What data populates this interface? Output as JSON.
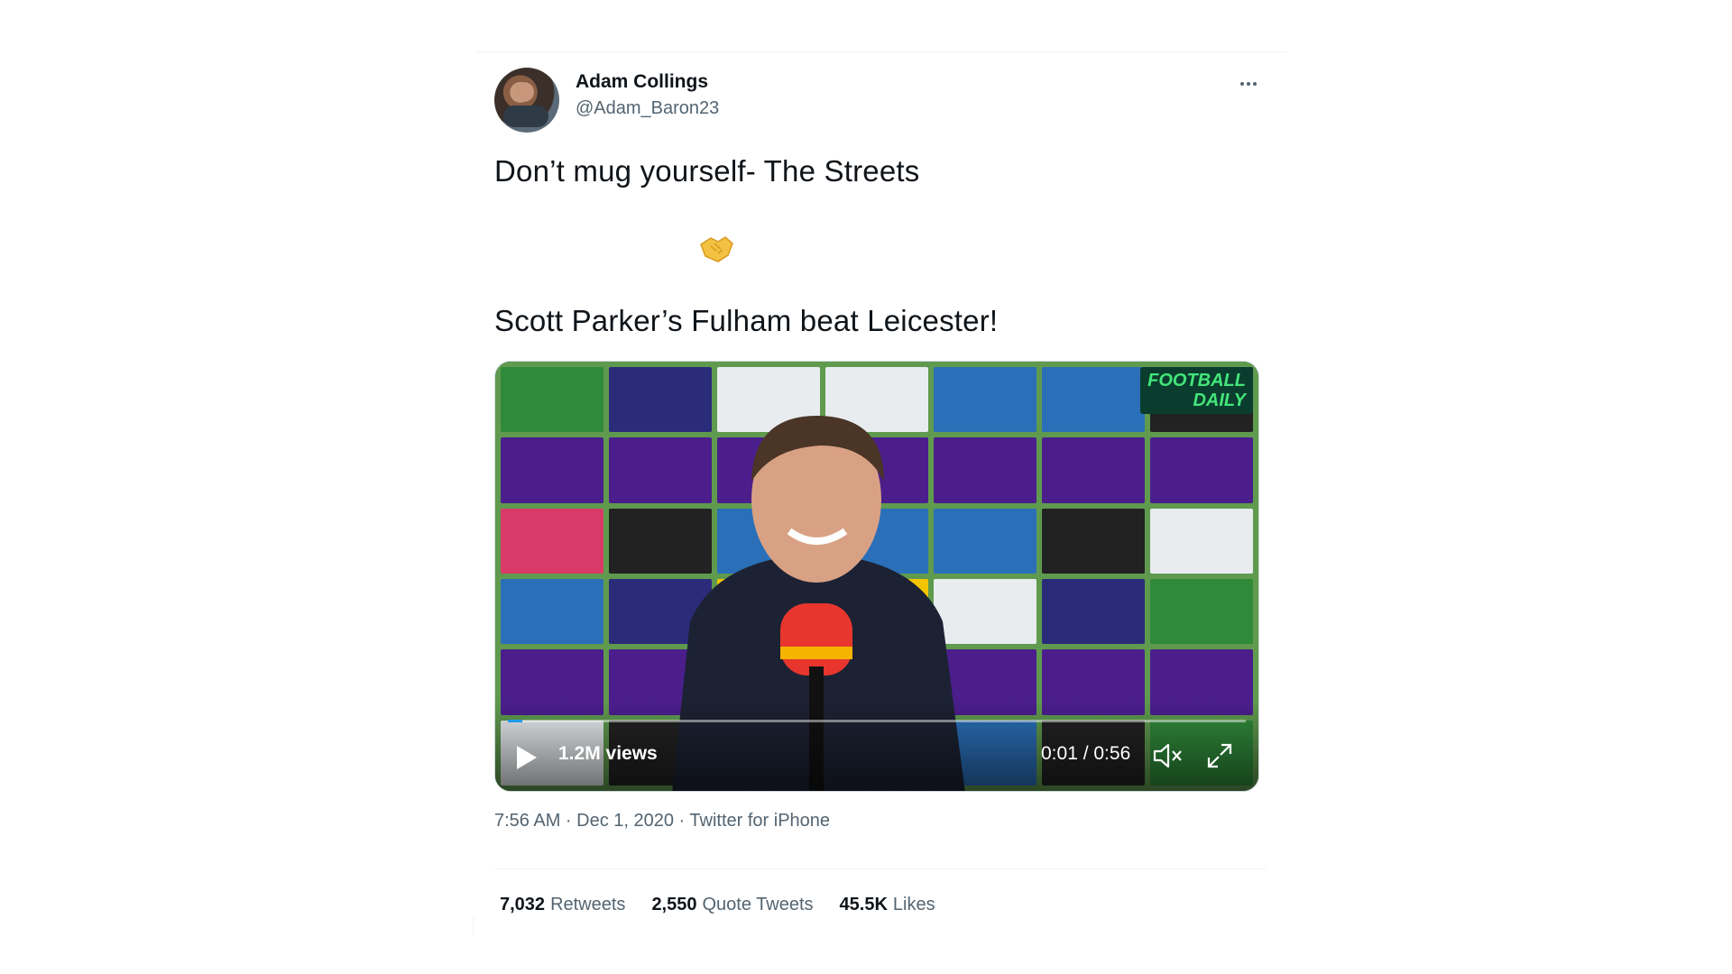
{
  "author": {
    "name": "Adam Collings",
    "handle": "@Adam_Baron23"
  },
  "tweet": {
    "line1": "Don’t mug yourself- The Streets",
    "emoji": "handshake-icon",
    "line2": "Scott Parker’s Fulham beat Leicester!"
  },
  "video": {
    "views": "1.2M views",
    "time": "0:01 / 0:56",
    "progress_fraction": 0.02,
    "badge_line1": "FOOTBALL",
    "badge_line2": "DAILY"
  },
  "meta": {
    "timestamp": "7:56 AM · Dec 1, 2020 · Twitter for iPhone"
  },
  "stats": {
    "retweets_count": "7,032",
    "retweets_label": "Retweets",
    "quotes_count": "2,550",
    "quotes_label": "Quote Tweets",
    "likes_count": "45.5K",
    "likes_label": "Likes"
  },
  "colors": {
    "text": "#0f1419",
    "secondary": "#536471",
    "accent": "#1d9bf0"
  }
}
